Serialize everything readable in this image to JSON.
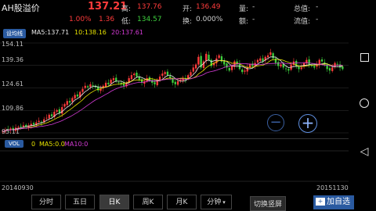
{
  "header": {
    "title": "AH股溢价",
    "price": "137.21",
    "change_pct": "1.00%",
    "change": "1.36",
    "high_label": "高:",
    "high_value": "137.76",
    "open_label": "开:",
    "open_value": "136.49",
    "low_label": "低:",
    "low_value": "134.57",
    "turnover_label": "换:",
    "turnover_value": "0.000%",
    "volume_label": "量:",
    "volume_value": "-",
    "amount_label": "额:",
    "amount_value": "-",
    "total_cap_label": "总值:",
    "total_cap_value": "-",
    "float_cap_label": "流值:",
    "float_cap_value": "-"
  },
  "ma_bar": {
    "settings_label": "设均线",
    "ma5": "MA5:137.71",
    "ma10": "10:138.16",
    "ma20": "20:137.61"
  },
  "price_axis": [
    "154.11",
    "139.36",
    "124.61",
    "109.86",
    "95.11"
  ],
  "vol_bar": {
    "label": "VOL",
    "value": "0",
    "ma5": "MA5:0.0",
    "ma10": "MA10:0"
  },
  "dates": {
    "start": "20140930",
    "end": "20151130"
  },
  "tabs": [
    {
      "label": "分时",
      "active": false
    },
    {
      "label": "五日",
      "active": false
    },
    {
      "label": "日K",
      "active": true
    },
    {
      "label": "周K",
      "active": false
    },
    {
      "label": "月K",
      "active": false
    },
    {
      "label": "分钟",
      "active": false
    }
  ],
  "actions": {
    "switch_label": "切换竖屏",
    "add_label": "加自选"
  },
  "colors": {
    "up": "#ff3b3b",
    "down": "#3ecf3e",
    "ma5": "#e8e8e8",
    "ma10": "#e5e100",
    "ma20": "#d43bd6",
    "accent": "#2a5aa0"
  },
  "chart_data": {
    "type": "candlestick",
    "ylim": [
      95.11,
      154.11
    ],
    "closes": [
      96,
      97,
      97.5,
      98,
      97,
      98.5,
      99,
      99.5,
      100,
      99,
      100,
      101,
      100.5,
      102,
      103,
      102,
      104,
      105,
      107,
      106,
      109,
      110,
      108,
      112,
      114,
      116,
      115,
      118,
      120,
      119,
      122,
      124,
      126,
      125,
      127,
      126,
      125,
      123,
      124,
      126,
      128,
      127,
      130,
      131,
      129,
      128,
      127,
      126,
      128,
      131,
      133,
      134,
      132,
      130,
      128,
      129,
      131,
      130,
      128,
      127,
      130,
      132,
      134,
      135,
      133,
      131,
      128,
      127,
      129,
      130,
      131,
      130,
      133,
      135,
      138,
      140,
      145,
      138,
      142,
      147,
      143,
      139,
      141,
      144,
      146,
      142,
      140,
      138,
      136,
      139,
      142,
      140,
      137,
      135,
      136,
      138,
      140,
      139,
      141,
      143,
      144,
      142,
      145,
      146,
      148,
      144,
      141,
      139,
      140,
      138,
      137,
      136,
      140,
      142,
      139,
      137,
      138,
      141,
      143,
      140,
      139,
      138,
      140,
      143,
      142,
      140,
      137,
      136,
      138,
      141,
      140,
      138,
      137
    ]
  }
}
